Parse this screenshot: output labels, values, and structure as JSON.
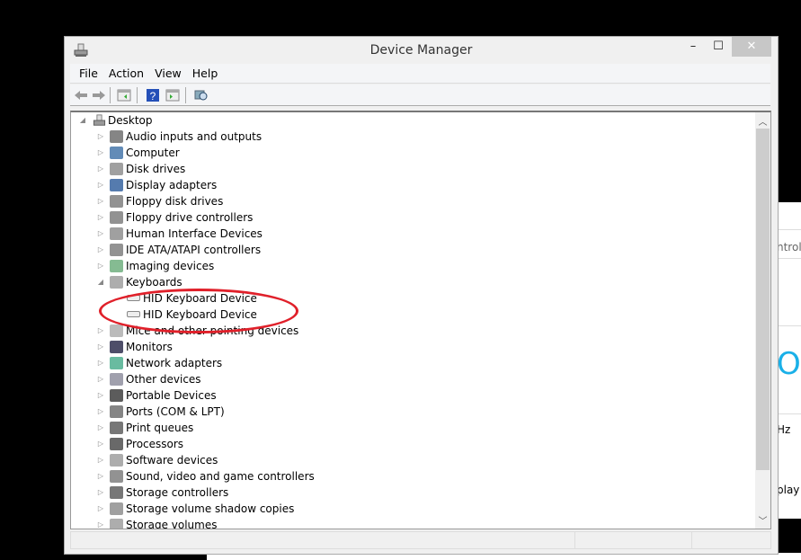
{
  "window": {
    "title": "Device Manager",
    "minimize": "–",
    "maximize": "☐",
    "close": "✕"
  },
  "menu": [
    "File",
    "Action",
    "View",
    "Help"
  ],
  "toolbar": [
    "back-icon",
    "forward-icon",
    "show-hide-console-tree-icon",
    "help-icon",
    "action-pane-icon",
    "scan-hardware-icon"
  ],
  "tree": {
    "root": "Desktop",
    "items": [
      {
        "label": "Audio inputs and outputs",
        "icon": "speaker-icon"
      },
      {
        "label": "Computer",
        "icon": "computer-icon"
      },
      {
        "label": "Disk drives",
        "icon": "disk-icon"
      },
      {
        "label": "Display adapters",
        "icon": "display-icon"
      },
      {
        "label": "Floppy disk drives",
        "icon": "floppy-icon"
      },
      {
        "label": "Floppy drive controllers",
        "icon": "controller-icon"
      },
      {
        "label": "Human Interface Devices",
        "icon": "hid-icon"
      },
      {
        "label": "IDE ATA/ATAPI controllers",
        "icon": "ide-icon"
      },
      {
        "label": "Imaging devices",
        "icon": "camera-icon"
      },
      {
        "label": "Keyboards",
        "icon": "keyboard-icon",
        "expanded": true,
        "children": [
          "HID Keyboard Device",
          "HID Keyboard Device"
        ]
      },
      {
        "label": "Mice and other pointing devices",
        "icon": "mouse-icon"
      },
      {
        "label": "Monitors",
        "icon": "monitor-icon"
      },
      {
        "label": "Network adapters",
        "icon": "network-icon"
      },
      {
        "label": "Other devices",
        "icon": "unknown-device-icon"
      },
      {
        "label": "Portable Devices",
        "icon": "portable-icon"
      },
      {
        "label": "Ports (COM & LPT)",
        "icon": "port-icon"
      },
      {
        "label": "Print queues",
        "icon": "printer-icon"
      },
      {
        "label": "Processors",
        "icon": "processor-icon"
      },
      {
        "label": "Software devices",
        "icon": "software-icon"
      },
      {
        "label": "Sound, video and game controllers",
        "icon": "sound-icon"
      },
      {
        "label": "Storage controllers",
        "icon": "storage-controller-icon"
      },
      {
        "label": "Storage volume shadow copies",
        "icon": "shadow-copy-icon"
      },
      {
        "label": "Storage volumes",
        "icon": "volume-icon"
      }
    ]
  },
  "background_window": {
    "texts": [
      "ntrol",
      "O",
      "Hz",
      "play"
    ]
  },
  "colors": {
    "annotation": "#e0202a",
    "accent": "#1ab0e8"
  }
}
